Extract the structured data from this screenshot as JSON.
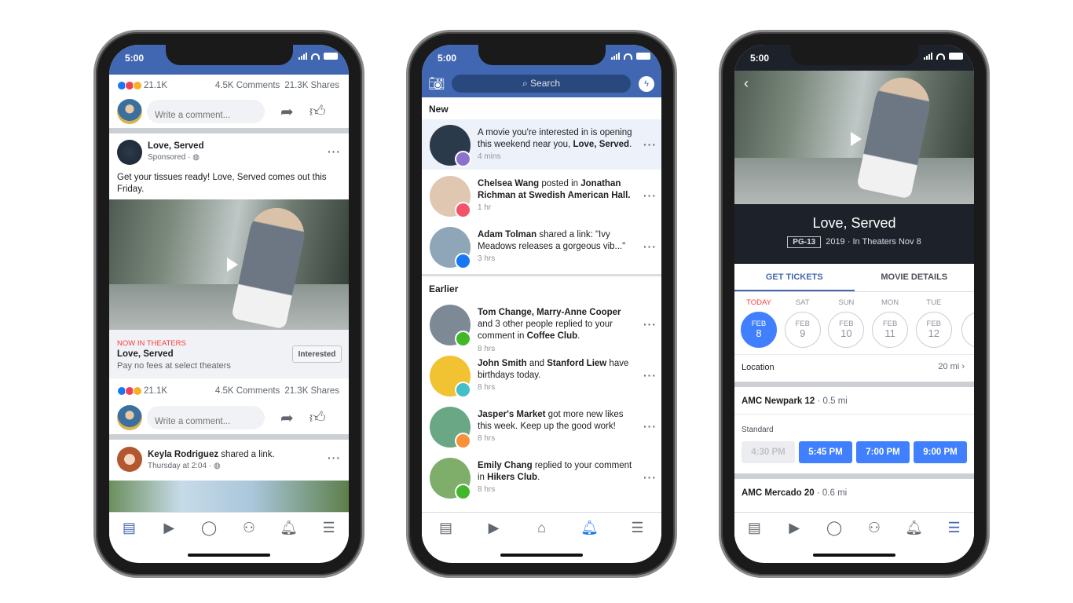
{
  "status_time": "5:00",
  "colors": {
    "brand": "#4267b2",
    "accent": "#1877f2",
    "now_in_theaters": "#fa3e3e"
  },
  "feed": {
    "reactions": "21.1K",
    "comments": "4.5K Comments",
    "shares": "21.3K Shares",
    "comment_placeholder": "Write a comment...",
    "post": {
      "author": "Love, Served",
      "meta": "Sponsored ·",
      "text": "Get your tissues ready! Love, Served comes out this Friday.",
      "cta_kicker": "NOW IN THEATERS",
      "cta_title": "Love, Served",
      "cta_sub": "Pay no fees at select theaters",
      "cta_button": "Interested"
    },
    "reactions2": "21.1K",
    "comments2": "4.5K Comments",
    "shares2": "21.3K Shares",
    "share_post": {
      "author": "Keyla Rodriguez",
      "action": " shared a link.",
      "meta": "Thursday at 2:04 ·"
    },
    "tabs": [
      "news-feed",
      "watch",
      "profile",
      "groups",
      "notifications",
      "menu"
    ]
  },
  "notifications": {
    "search_placeholder": "Search",
    "new_label": "New",
    "earlier_label": "Earlier",
    "new_items": [
      {
        "parts": [
          {
            "t": "A movie you're interested in is opening this weekend near you, "
          },
          {
            "t": "Love, Served",
            "b": true
          },
          {
            "t": "."
          }
        ],
        "time": "4 mins",
        "highlight": true,
        "badge": "#8c72cb",
        "avatar": "love-served-poster"
      },
      {
        "parts": [
          {
            "t": "Chelsea Wang",
            "b": true
          },
          {
            "t": " posted in "
          },
          {
            "t": "Jonathan Richman at Swedish American Hall.",
            "b": true
          }
        ],
        "time": "1 hr",
        "badge": "#f35369",
        "avatar": "chelsea-wang"
      },
      {
        "parts": [
          {
            "t": "Adam Tolman",
            "b": true
          },
          {
            "t": " shared a link: \"Ivy Meadows releases a gorgeous vib...\""
          }
        ],
        "time": "3 hrs",
        "badge": "#1877f2",
        "avatar": "adam-tolman"
      }
    ],
    "earlier_items": [
      {
        "parts": [
          {
            "t": "Tom Change, Marry-Anne Cooper",
            "b": true
          },
          {
            "t": " and 3 other people replied to your comment in "
          },
          {
            "t": "Coffee Club",
            "b": true
          },
          {
            "t": "."
          }
        ],
        "time": "8 hrs",
        "badge": "#42b72a",
        "avatar": "tom-change"
      },
      {
        "parts": [
          {
            "t": "John Smith",
            "b": true
          },
          {
            "t": " and "
          },
          {
            "t": "Stanford Liew",
            "b": true
          },
          {
            "t": " have birthdays today."
          }
        ],
        "time": "8 hrs",
        "badge": "#44bec7",
        "avatar": "john-smith"
      },
      {
        "parts": [
          {
            "t": "Jasper's Market",
            "b": true
          },
          {
            "t": " got more new likes this week. Keep up the good work!"
          }
        ],
        "time": "8 hrs",
        "badge": "#f7923b",
        "avatar": "jaspers-market"
      },
      {
        "parts": [
          {
            "t": "Emily Chang",
            "b": true
          },
          {
            "t": " replied to your comment in "
          },
          {
            "t": "Hikers Club",
            "b": true
          },
          {
            "t": "."
          }
        ],
        "time": "8 hrs",
        "badge": "#42b72a",
        "avatar": "emily-chang"
      }
    ]
  },
  "movie": {
    "title": "Love, Served",
    "rating": "PG-13",
    "year": "2019",
    "release": "In Theaters Nov 8",
    "tabs": [
      {
        "label": "GET TICKETS",
        "active": true
      },
      {
        "label": "MOVIE DETAILS",
        "active": false
      }
    ],
    "days": [
      {
        "name": "TODAY",
        "month": "FEB",
        "day": "8",
        "selected": true
      },
      {
        "name": "SAT",
        "month": "FEB",
        "day": "9"
      },
      {
        "name": "SUN",
        "month": "FEB",
        "day": "10"
      },
      {
        "name": "MON",
        "month": "FEB",
        "day": "11"
      },
      {
        "name": "TUE",
        "month": "FEB",
        "day": "12"
      }
    ],
    "location_label": "Location",
    "location_value": "20 mi",
    "theaters": [
      {
        "name": "AMC Newpark 12",
        "distance": " · 0.5 mi",
        "format": "Standard",
        "times": [
          {
            "t": "4:30 PM",
            "disabled": true
          },
          {
            "t": "5:45 PM"
          },
          {
            "t": "7:00 PM"
          },
          {
            "t": "9:00 PM"
          }
        ]
      },
      {
        "name": "AMC Mercado 20",
        "distance": " · 0.6 mi"
      }
    ]
  }
}
